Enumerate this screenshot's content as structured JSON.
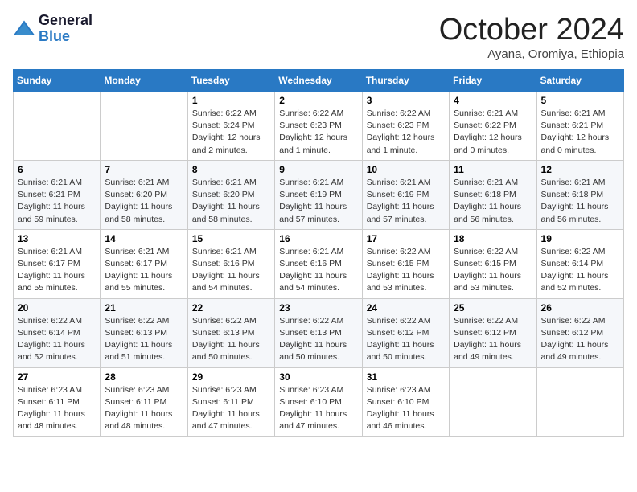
{
  "header": {
    "logo_line1": "General",
    "logo_line2": "Blue",
    "month": "October 2024",
    "location": "Ayana, Oromiya, Ethiopia"
  },
  "weekdays": [
    "Sunday",
    "Monday",
    "Tuesday",
    "Wednesday",
    "Thursday",
    "Friday",
    "Saturday"
  ],
  "weeks": [
    [
      {
        "day": null
      },
      {
        "day": null
      },
      {
        "day": "1",
        "sunrise": "6:22 AM",
        "sunset": "6:24 PM",
        "daylight": "12 hours and 2 minutes."
      },
      {
        "day": "2",
        "sunrise": "6:22 AM",
        "sunset": "6:23 PM",
        "daylight": "12 hours and 1 minute."
      },
      {
        "day": "3",
        "sunrise": "6:22 AM",
        "sunset": "6:23 PM",
        "daylight": "12 hours and 1 minute."
      },
      {
        "day": "4",
        "sunrise": "6:21 AM",
        "sunset": "6:22 PM",
        "daylight": "12 hours and 0 minutes."
      },
      {
        "day": "5",
        "sunrise": "6:21 AM",
        "sunset": "6:21 PM",
        "daylight": "12 hours and 0 minutes."
      }
    ],
    [
      {
        "day": "6",
        "sunrise": "6:21 AM",
        "sunset": "6:21 PM",
        "daylight": "11 hours and 59 minutes."
      },
      {
        "day": "7",
        "sunrise": "6:21 AM",
        "sunset": "6:20 PM",
        "daylight": "11 hours and 58 minutes."
      },
      {
        "day": "8",
        "sunrise": "6:21 AM",
        "sunset": "6:20 PM",
        "daylight": "11 hours and 58 minutes."
      },
      {
        "day": "9",
        "sunrise": "6:21 AM",
        "sunset": "6:19 PM",
        "daylight": "11 hours and 57 minutes."
      },
      {
        "day": "10",
        "sunrise": "6:21 AM",
        "sunset": "6:19 PM",
        "daylight": "11 hours and 57 minutes."
      },
      {
        "day": "11",
        "sunrise": "6:21 AM",
        "sunset": "6:18 PM",
        "daylight": "11 hours and 56 minutes."
      },
      {
        "day": "12",
        "sunrise": "6:21 AM",
        "sunset": "6:18 PM",
        "daylight": "11 hours and 56 minutes."
      }
    ],
    [
      {
        "day": "13",
        "sunrise": "6:21 AM",
        "sunset": "6:17 PM",
        "daylight": "11 hours and 55 minutes."
      },
      {
        "day": "14",
        "sunrise": "6:21 AM",
        "sunset": "6:17 PM",
        "daylight": "11 hours and 55 minutes."
      },
      {
        "day": "15",
        "sunrise": "6:21 AM",
        "sunset": "6:16 PM",
        "daylight": "11 hours and 54 minutes."
      },
      {
        "day": "16",
        "sunrise": "6:21 AM",
        "sunset": "6:16 PM",
        "daylight": "11 hours and 54 minutes."
      },
      {
        "day": "17",
        "sunrise": "6:22 AM",
        "sunset": "6:15 PM",
        "daylight": "11 hours and 53 minutes."
      },
      {
        "day": "18",
        "sunrise": "6:22 AM",
        "sunset": "6:15 PM",
        "daylight": "11 hours and 53 minutes."
      },
      {
        "day": "19",
        "sunrise": "6:22 AM",
        "sunset": "6:14 PM",
        "daylight": "11 hours and 52 minutes."
      }
    ],
    [
      {
        "day": "20",
        "sunrise": "6:22 AM",
        "sunset": "6:14 PM",
        "daylight": "11 hours and 52 minutes."
      },
      {
        "day": "21",
        "sunrise": "6:22 AM",
        "sunset": "6:13 PM",
        "daylight": "11 hours and 51 minutes."
      },
      {
        "day": "22",
        "sunrise": "6:22 AM",
        "sunset": "6:13 PM",
        "daylight": "11 hours and 50 minutes."
      },
      {
        "day": "23",
        "sunrise": "6:22 AM",
        "sunset": "6:13 PM",
        "daylight": "11 hours and 50 minutes."
      },
      {
        "day": "24",
        "sunrise": "6:22 AM",
        "sunset": "6:12 PM",
        "daylight": "11 hours and 50 minutes."
      },
      {
        "day": "25",
        "sunrise": "6:22 AM",
        "sunset": "6:12 PM",
        "daylight": "11 hours and 49 minutes."
      },
      {
        "day": "26",
        "sunrise": "6:22 AM",
        "sunset": "6:12 PM",
        "daylight": "11 hours and 49 minutes."
      }
    ],
    [
      {
        "day": "27",
        "sunrise": "6:23 AM",
        "sunset": "6:11 PM",
        "daylight": "11 hours and 48 minutes."
      },
      {
        "day": "28",
        "sunrise": "6:23 AM",
        "sunset": "6:11 PM",
        "daylight": "11 hours and 48 minutes."
      },
      {
        "day": "29",
        "sunrise": "6:23 AM",
        "sunset": "6:11 PM",
        "daylight": "11 hours and 47 minutes."
      },
      {
        "day": "30",
        "sunrise": "6:23 AM",
        "sunset": "6:10 PM",
        "daylight": "11 hours and 47 minutes."
      },
      {
        "day": "31",
        "sunrise": "6:23 AM",
        "sunset": "6:10 PM",
        "daylight": "11 hours and 46 minutes."
      },
      {
        "day": null
      },
      {
        "day": null
      }
    ]
  ],
  "labels": {
    "sunrise": "Sunrise:",
    "sunset": "Sunset:",
    "daylight": "Daylight:"
  }
}
